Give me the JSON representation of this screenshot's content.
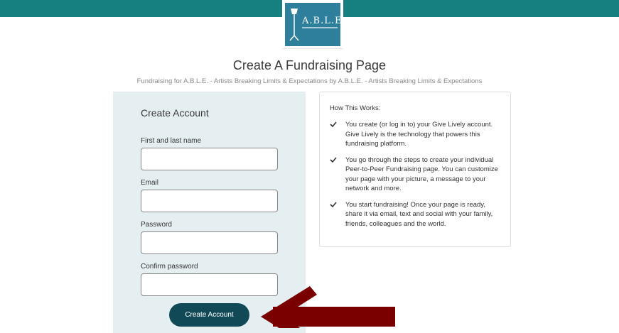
{
  "header": {
    "logo_text": "A.B.L.E.",
    "brand_color": "#167f7f",
    "logo_color": "#2e7f9c"
  },
  "page": {
    "title": "Create A Fundraising Page",
    "subtitle": "Fundraising for A.B.L.E. - Artists Breaking Limits & Expectations by A.B.L.E. - Artists Breaking Limits & Expectations"
  },
  "form": {
    "title": "Create Account",
    "fields": [
      {
        "label": "First and last name",
        "value": ""
      },
      {
        "label": "Email",
        "value": ""
      },
      {
        "label": "Password",
        "value": ""
      },
      {
        "label": "Confirm password",
        "value": ""
      }
    ],
    "submit_label": "Create Account",
    "panel_color": "#e5eff2",
    "button_color": "#114a56"
  },
  "info": {
    "title": "How This Works:",
    "items": [
      "You create (or log in to) your Give Lively account. Give Lively is the technology that powers this fundraising platform.",
      "You go through the steps to create your individual Peer-to-Peer Fundraising page. You can customize your page with your picture, a message to your network and more.",
      "You start fundraising! Once your page is ready, share it via email, text and social with your family, friends, colleagues and the world."
    ],
    "icon": "check-icon"
  },
  "annotation": {
    "icon": "arrow-icon",
    "color": "#7a0000"
  }
}
